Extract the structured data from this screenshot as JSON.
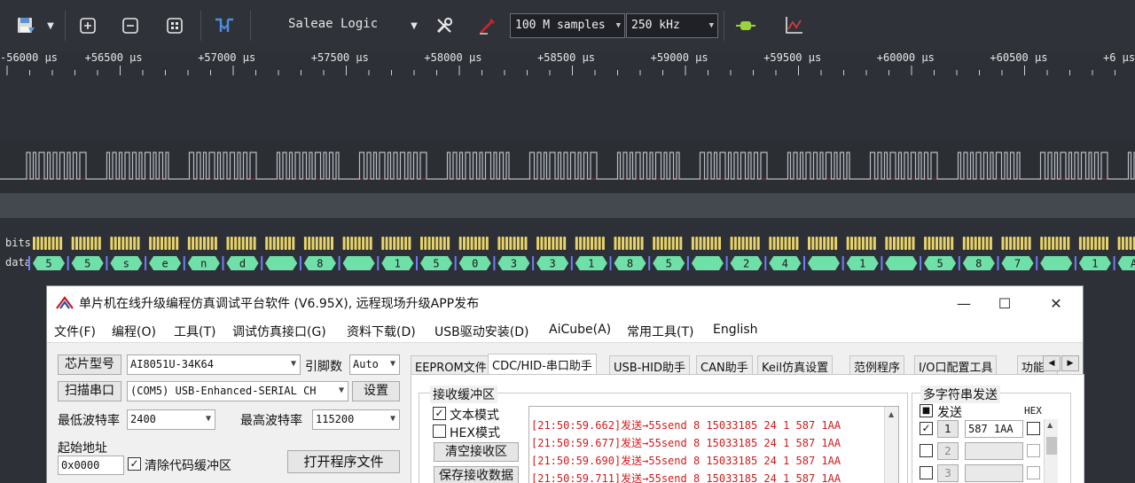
{
  "toolbar": {
    "device_name": "Saleae Logic",
    "samples": "100 M samples",
    "rate": "250 kHz"
  },
  "ruler": {
    "unit": "μs",
    "labels": [
      "-56000",
      "+56500",
      "+57000",
      "+57500",
      "+58000",
      "+58500",
      "+59000",
      "+59500",
      "+60000",
      "+60500",
      "+6"
    ]
  },
  "channels": {
    "bits_label": "bits",
    "data_label": "data",
    "data_values": [
      "5",
      "5",
      "s",
      "e",
      "n",
      "d",
      "",
      "8",
      "",
      "1",
      "5",
      "0",
      "3",
      "3",
      "1",
      "8",
      "5",
      "",
      "2",
      "4",
      "",
      "1",
      "",
      "5",
      "8",
      "7",
      "",
      "1",
      "A"
    ]
  },
  "window": {
    "title": "单片机在线升级编程仿真调试平台软件 (V6.95X), 远程现场升级APP发布",
    "controls": {
      "minimize": "—",
      "maximize": "☐",
      "close": "✕"
    },
    "menu": [
      "文件(F)",
      "编程(O)",
      "工具(T)",
      "调试仿真接口(G)",
      "资料下载(D)",
      "USB驱动安装(D)",
      "AiCube(A)",
      "常用工具(T)",
      "English"
    ],
    "left": {
      "chip_type_btn": "芯片型号",
      "chip_type": "AI8051U-34K64",
      "pin_count_label": "引脚数",
      "pin_count": "Auto",
      "scan_port_btn": "扫描串口",
      "port": "(COM5) USB-Enhanced-SERIAL CH",
      "settings_btn": "设置",
      "min_baud_label": "最低波特率",
      "min_baud": "2400",
      "max_baud_label": "最高波特率",
      "max_baud": "115200",
      "start_addr_label": "起始地址",
      "start_addr": "0x0000",
      "clear_code_label": "清除代码缓冲区",
      "open_program_btn": "打开程序文件"
    },
    "tabs": [
      "EEPROM文件",
      "CDC/HID-串口助手",
      "USB-HID助手",
      "CAN助手",
      "Keil仿真设置",
      "范例程序",
      "I/O口配置工具",
      "功能"
    ],
    "serial": {
      "recv_title": "接收缓冲区",
      "text_mode": "文本模式",
      "hex_mode": "HEX模式",
      "clear_recv_btn": "清空接收区",
      "save_recv_btn": "保存接收数据",
      "log": [
        "[21:50:59.662]发送→55send 8 15033185 24 1 587 1AA",
        "[21:50:59.677]发送→55send 8 15033185 24 1 587 1AA",
        "[21:50:59.690]发送→55send 8 15033185 24 1 587 1AA",
        "[21:50:59.711]发送→55send 8 15033185 24 1 587 1AA"
      ],
      "multi_title": "多字符串发送",
      "send_label": "发送",
      "hex_label": "HEX",
      "rows": [
        {
          "index": "1",
          "value": "587 1AA"
        },
        {
          "index": "2",
          "value": ""
        },
        {
          "index": "3",
          "value": ""
        }
      ]
    }
  },
  "colors": {
    "bg": "#2d3036",
    "signal": "#b9bec6",
    "bits": "#e8d36a",
    "data": "#6fe0a8",
    "log": "#d11a1a"
  }
}
